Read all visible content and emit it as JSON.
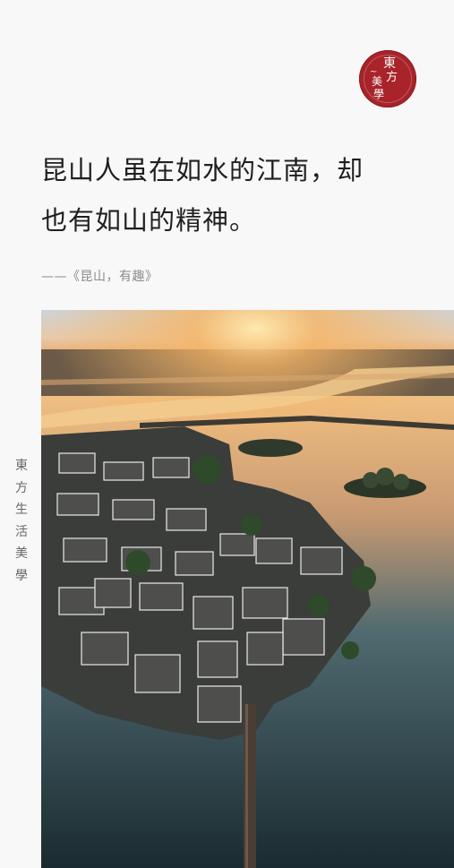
{
  "brand": {
    "seal_chars": [
      "東",
      "方",
      "美",
      "學"
    ],
    "seal_decoration": "~",
    "seal_color": "#a8232a",
    "vertical_text": [
      "東",
      "方",
      "生",
      "活",
      "美",
      "學"
    ]
  },
  "article": {
    "quote_line_1": "昆山人虽在如水的江南，却",
    "quote_line_2": "也有如山的精神。",
    "source": "——《昆山，有趣》"
  },
  "image": {
    "icon": "aerial-water-town-photo"
  }
}
